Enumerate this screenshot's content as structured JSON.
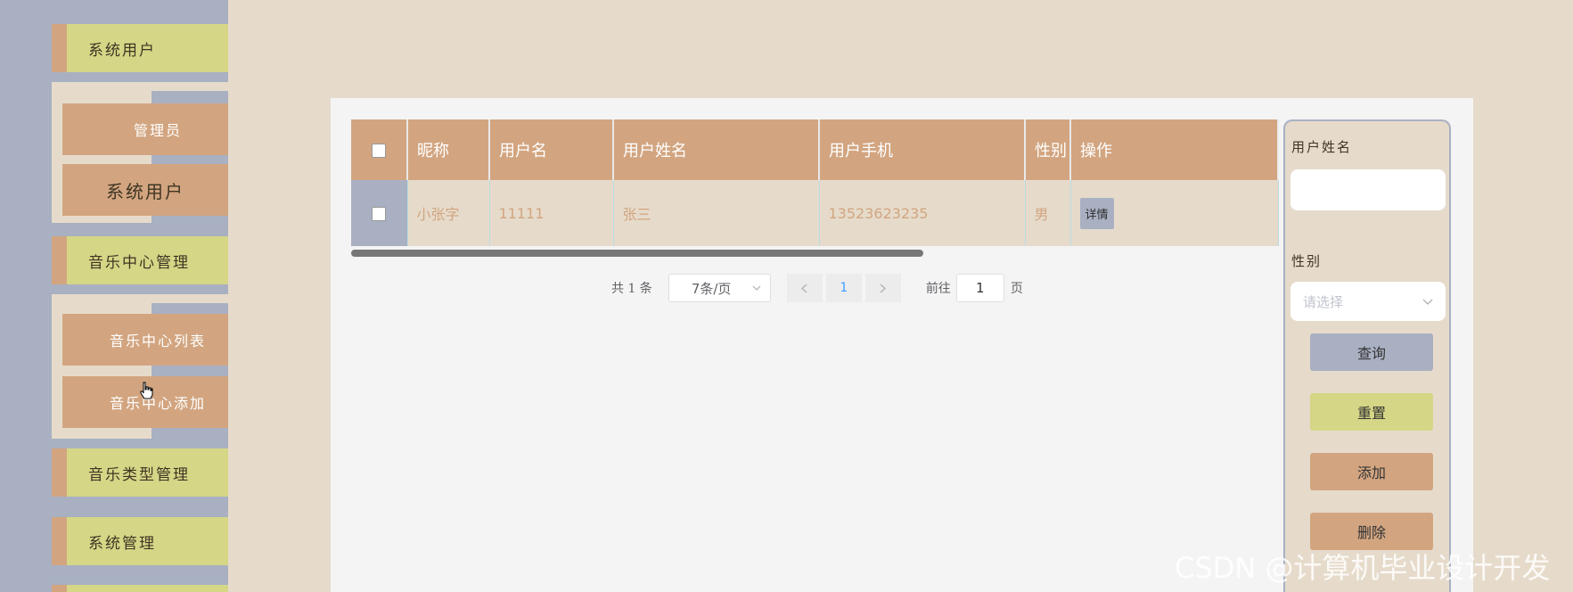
{
  "sidebar": {
    "groups": {
      "system_user": "系统用户",
      "music_center": "音乐中心管理",
      "music_type": "音乐类型管理",
      "system_manage": "系统管理"
    },
    "system_user_items": {
      "admin": "管理员",
      "system_user": "系统用户"
    },
    "music_center_items": {
      "list": "音乐中心列表",
      "add": "音乐中心添加"
    }
  },
  "table": {
    "headers": {
      "nickname": "昵称",
      "username": "用户名",
      "real_name": "用户姓名",
      "phone": "用户手机",
      "gender": "性别",
      "action": "操作"
    },
    "rows": [
      {
        "nickname": "小张字",
        "username": "11111",
        "real_name": "张三",
        "phone": "13523623235",
        "gender": "男",
        "detail_label": "详情"
      }
    ]
  },
  "pagination": {
    "total_text": "共 1 条",
    "page_size": "7条/页",
    "current_page": "1",
    "goto_label": "前往",
    "goto_value": "1",
    "page_suffix": "页"
  },
  "search": {
    "name_label": "用户姓名",
    "name_value": "",
    "gender_label": "性别",
    "gender_placeholder": "请选择",
    "query_button": "查询",
    "reset_button": "重置",
    "add_button": "添加",
    "delete_button": "删除"
  },
  "watermark": "CSDN @计算机毕业设计开发",
  "colors": {
    "background": "#e6dbcb",
    "sidebar": "#a9b0c2",
    "accent_tan": "#d2a580",
    "accent_olive": "#d5d686",
    "card": "#f4f4f4",
    "link_blue": "#409eff"
  }
}
